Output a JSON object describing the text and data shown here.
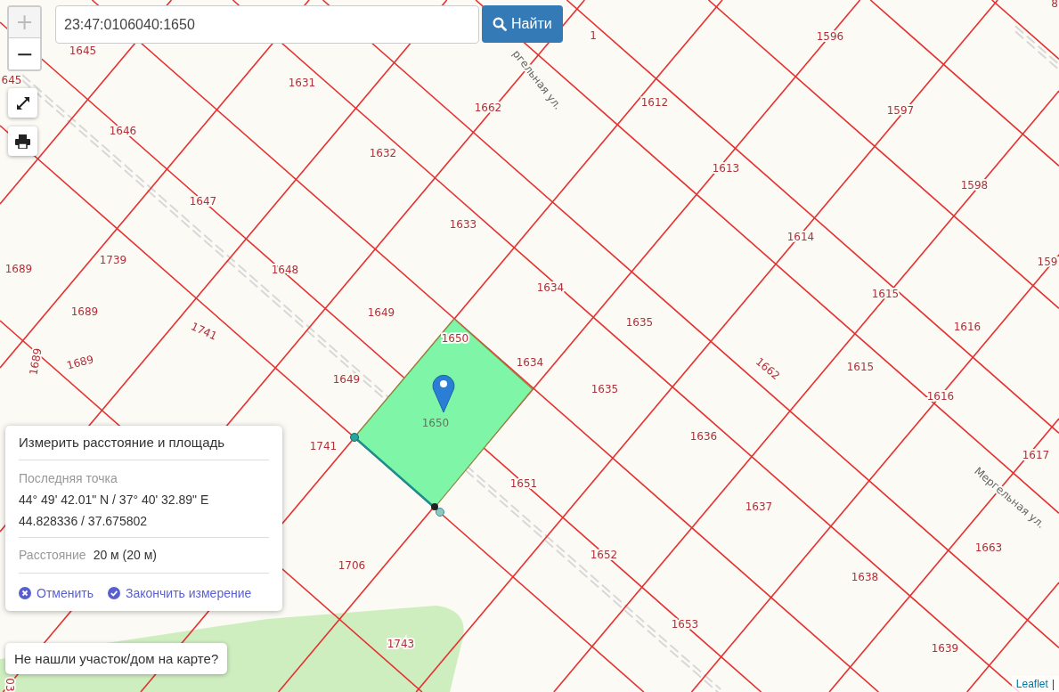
{
  "search": {
    "value": "23:47:0106040:1650",
    "button": "Найти"
  },
  "zoom": [
    {
      "label": "+",
      "disabled": true
    },
    {
      "label": "−",
      "disabled": false
    }
  ],
  "map": {
    "parcels": [
      {
        "label": "1645",
        "selected": false
      },
      {
        "label": "645",
        "selected": false
      },
      {
        "label": "1",
        "selected": false
      },
      {
        "label": "1631",
        "selected": false
      },
      {
        "label": "1646",
        "selected": false
      },
      {
        "label": "1662",
        "selected": false
      },
      {
        "label": "1612",
        "selected": false
      },
      {
        "label": "1596",
        "selected": false
      },
      {
        "label": "1597",
        "selected": false
      },
      {
        "label": "8",
        "selected": false
      },
      {
        "label": "1598",
        "selected": false
      },
      {
        "label": "159",
        "selected": false
      },
      {
        "label": "1632",
        "selected": false
      },
      {
        "label": "1613",
        "selected": false
      },
      {
        "label": "1647",
        "selected": false
      },
      {
        "label": "1633",
        "selected": false
      },
      {
        "label": "1614",
        "selected": false
      },
      {
        "label": "1689",
        "selected": false
      },
      {
        "label": "1739",
        "selected": false
      },
      {
        "label": "1648",
        "selected": false
      },
      {
        "label": "1634",
        "selected": false
      },
      {
        "label": "1615",
        "selected": false
      },
      {
        "label": "1689",
        "selected": false
      },
      {
        "label": "1649",
        "selected": false
      },
      {
        "label": "1635",
        "selected": false
      },
      {
        "label": "1616",
        "selected": false
      },
      {
        "label": "1741",
        "selected": false
      },
      {
        "label": "1650",
        "selected": false
      },
      {
        "label": "1634",
        "selected": false
      },
      {
        "label": "1662",
        "selected": false
      },
      {
        "label": "1615",
        "selected": false
      },
      {
        "label": "1689",
        "selected": false
      },
      {
        "label": "1689",
        "selected": false
      },
      {
        "label": "1649",
        "selected": false
      },
      {
        "label": "1635",
        "selected": false
      },
      {
        "label": "1616",
        "selected": false
      },
      {
        "label": "1650",
        "selected": true
      },
      {
        "label": "1741",
        "selected": false
      },
      {
        "label": "1636",
        "selected": false
      },
      {
        "label": "1617",
        "selected": false
      },
      {
        "label": "1651",
        "selected": false
      },
      {
        "label": "1637",
        "selected": false
      },
      {
        "label": "1663",
        "selected": false
      },
      {
        "label": "1706",
        "selected": false
      },
      {
        "label": "1652",
        "selected": false
      },
      {
        "label": "1638",
        "selected": false
      },
      {
        "label": "1743",
        "selected": false
      },
      {
        "label": "1653",
        "selected": false
      },
      {
        "label": "1639",
        "selected": false
      },
      {
        "label": "03",
        "selected": false
      }
    ],
    "streets": [
      "ргельная ул.",
      "Мергельная ул."
    ]
  },
  "measure": {
    "title": "Измерить расстояние и площадь",
    "last_point_label": "Последняя точка",
    "coords_dms": "44° 49' 42.01\" N / 37° 40' 32.89\" E",
    "coords_decimal": "44.828336 / 37.675802",
    "distance_label": "Расстояние",
    "distance_value": "20 м (20 м)",
    "actions": [
      {
        "label": "Отменить",
        "kind": "cancel"
      },
      {
        "label": "Закончить измерение",
        "kind": "finish"
      }
    ]
  },
  "help_button": "Не нашли участок/дом на карте?",
  "attribution": {
    "link": "Leaflet",
    "separator": "|"
  }
}
